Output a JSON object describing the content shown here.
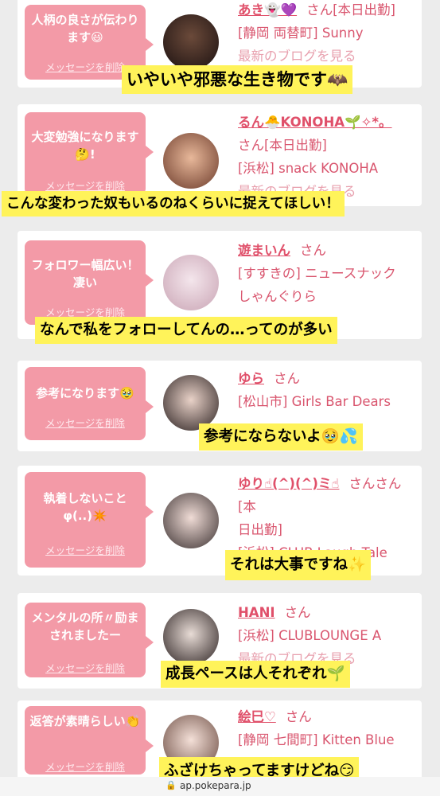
{
  "delete_label": "メッセージを削除",
  "honorific": "さん",
  "accent": "#f39aa7",
  "highlight": "#fff35a",
  "cards": [
    {
      "message": "人柄の良さが伝わります😃",
      "name": "あき👻💜",
      "line1": "[本日出勤]",
      "line2": "[静岡 両替町] Sunny",
      "line3": "最新のブログを見る",
      "caption": "いやいや邪悪な生き物です🦇"
    },
    {
      "message": "大変勉強になります🤔!",
      "name": "るん🐣KONOHA🌱✧*。",
      "line1": "さん[本日出勤]",
      "line2": "[浜松] snack KONOHA",
      "line3": "最新のブログを見る",
      "caption": "こんな変わった奴もいるのねくらいに捉えてほしい！"
    },
    {
      "message": "フォロワー幅広い！凄い",
      "name": "遊まいん",
      "line1": "[すすきの] ニュースナック",
      "line2": "しゃんぐりら",
      "line3": "",
      "caption": "なんで私をフォローしてんの…ってのが多い"
    },
    {
      "message": "参考になります🥹",
      "name": "ゆら",
      "line1": "[松山市] Girls Bar Dears",
      "line2": "",
      "line3": "",
      "caption": "参考にならないよ🥹💦"
    },
    {
      "message": "執着しないことφ(..)✴️",
      "name": "ゆり☝(^)(^)ミ☝",
      "line1": "さん[本",
      "line2": "日出勤]",
      "line3": "[浜松] CLUB Laugh Tale",
      "caption": "それは大事ですね✨"
    },
    {
      "message": "メンタルの所〃励まされましたー",
      "name": "HANI",
      "line1": "[浜松] CLUBLOUNGE A",
      "line2": "最新のブログを見る",
      "line3": "",
      "caption": "成長ペースは人それぞれ🌱"
    },
    {
      "message": "返答が素晴らしい👏",
      "name": "絵巳♡",
      "line1": "[静岡 七間町] Kitten Blue",
      "line2": "",
      "line3": "",
      "caption": "ふざけちゃってますけどね😏"
    }
  ],
  "footer": {
    "url": "ap.pokepara.jp"
  }
}
